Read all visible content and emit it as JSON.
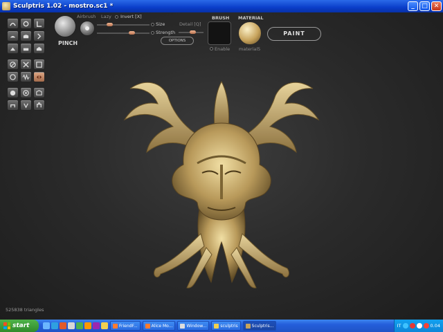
{
  "window": {
    "title": "Sculptris 1.02 - mostro.sc1 *"
  },
  "toolbar": {
    "tool_name": "PINCH",
    "airbrush_label": "Airbrush",
    "lazy_label": "Lazy",
    "invert_label": "Invert [X]",
    "size_label": "Size",
    "strength_label": "Strength",
    "detail_label": "Detail [Q]",
    "options_label": "OPTIONS",
    "brush_label": "BRUSH",
    "enable_label": "Enable",
    "material_label": "MATERIAL",
    "material_name": "material5",
    "paint_label": "PAINT"
  },
  "tools": {
    "rows": [
      [
        "draw-icon",
        "rotate-icon",
        "crease-icon"
      ],
      [
        "flatten-icon",
        "smooth-icon",
        "inflate-icon"
      ],
      [
        "pinch-icon",
        "grab-icon",
        "scale-icon"
      ],
      [
        "sym-icon",
        "mirror-icon",
        "mask-icon"
      ],
      [
        "wire-icon",
        "wave-icon",
        "swap-icon"
      ],
      [
        "sphere-icon",
        "cube-icon",
        "plane-icon"
      ],
      [
        "undo-icon",
        "redo-icon",
        "settings-icon"
      ]
    ],
    "active": "swap-icon"
  },
  "status": {
    "triangles": "525838 triangles"
  },
  "colors": {
    "material_gold": "#c7a35c",
    "accent_knob": "#d38c67"
  },
  "taskbar": {
    "start_label": "start",
    "tasks": [
      {
        "label": "FriendF..."
      },
      {
        "label": "Alice Mo..."
      },
      {
        "label": "Window..."
      },
      {
        "label": "sculptris"
      },
      {
        "label": "Sculptris..."
      }
    ],
    "tray_lang": "IT",
    "clock": "0.04"
  }
}
